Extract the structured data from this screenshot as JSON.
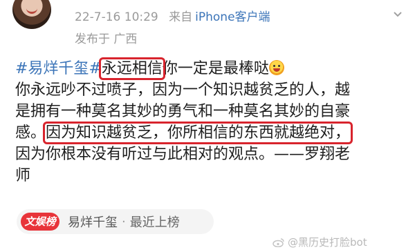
{
  "post": {
    "timestamp": "22-7-16 10:29",
    "source_prefix": "来自",
    "device": "iPhone客户端",
    "location": "发布于 广西",
    "content": {
      "hashtag": "#易烊千玺#",
      "boxed1": "永远相信",
      "line1_rest": "你一定是最棒哒",
      "line2": "你永远吵不过喷子，因为一个知识越贫乏的人，越",
      "line3": "是拥有一种莫名其妙的勇气和一种莫名其妙的自豪",
      "line4_start": "感。",
      "boxed2": "因为知识越贫乏，你所相信的东西就越绝对，",
      "line5": "因为你根本没有听过与此相对的观点。——罗翔老",
      "line6": "师"
    }
  },
  "tag": {
    "logo": "文娱榜",
    "name": "易烊千玺",
    "separator": "·",
    "status": "最近上榜"
  },
  "watermark": {
    "text": "@黑历史打脸bot"
  },
  "icons": [
    "avatar",
    "chevron-down-icon",
    "smiley-emoji-icon",
    "weibo-logo-icon"
  ],
  "colors": {
    "link": "#3b74b8",
    "highlight_box": "#d8242d",
    "meta": "#9a9a9a",
    "tag_logo": "#e8343a"
  }
}
